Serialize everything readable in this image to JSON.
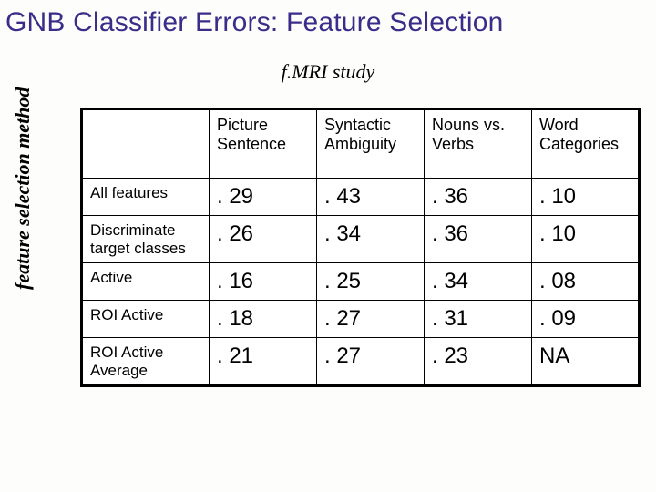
{
  "title": "GNB Classifier Errors: Feature Selection",
  "subtitle": "f.MRI study",
  "ylabel": "feature selection method",
  "columns": [
    "Picture Sentence",
    "Syntactic Ambiguity",
    "Nouns vs. Verbs",
    "Word Categories"
  ],
  "rows": [
    {
      "name": "All features",
      "values": [
        ". 29",
        ". 43",
        ". 36",
        ". 10"
      ]
    },
    {
      "name": "Discriminate target classes",
      "values": [
        ". 26",
        ". 34",
        ". 36",
        ". 10"
      ]
    },
    {
      "name": "Active",
      "values": [
        ". 16",
        ". 25",
        ". 34",
        ". 08"
      ]
    },
    {
      "name": "ROI Active",
      "values": [
        ". 18",
        ". 27",
        ". 31",
        ". 09"
      ]
    },
    {
      "name": "ROI Active Average",
      "values": [
        ". 21",
        ". 27",
        ". 23",
        "NA"
      ]
    }
  ],
  "chart_data": {
    "type": "table",
    "title": "GNB Classifier Errors: Feature Selection — f.MRI study",
    "xlabel": "f.MRI study",
    "ylabel": "feature selection method",
    "categories": [
      "Picture Sentence",
      "Syntactic Ambiguity",
      "Nouns vs. Verbs",
      "Word Categories"
    ],
    "series": [
      {
        "name": "All features",
        "values": [
          0.29,
          0.43,
          0.36,
          0.1
        ]
      },
      {
        "name": "Discriminate target classes",
        "values": [
          0.26,
          0.34,
          0.36,
          0.1
        ]
      },
      {
        "name": "Active",
        "values": [
          0.16,
          0.25,
          0.34,
          0.08
        ]
      },
      {
        "name": "ROI Active",
        "values": [
          0.18,
          0.27,
          0.31,
          0.09
        ]
      },
      {
        "name": "ROI Active Average",
        "values": [
          0.21,
          0.27,
          0.23,
          null
        ]
      }
    ]
  }
}
